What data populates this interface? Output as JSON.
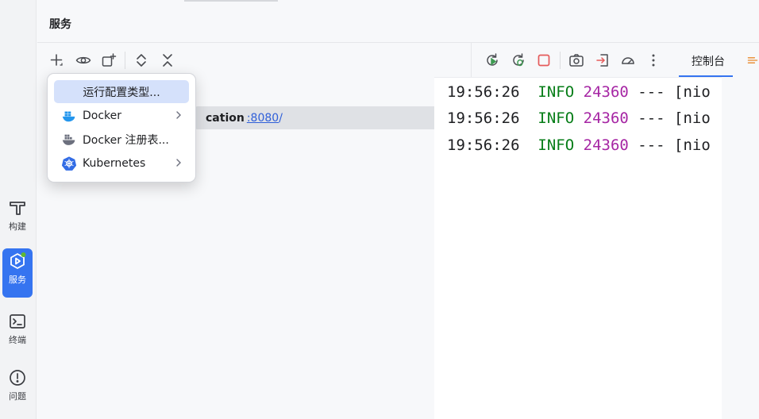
{
  "sidebar": {
    "tools": [
      {
        "label": "构建",
        "icon": "hammer-icon"
      },
      {
        "label": "服务",
        "icon": "services-icon",
        "active": true
      },
      {
        "label": "终端",
        "icon": "terminal-icon"
      },
      {
        "label": "问题",
        "icon": "problems-icon"
      }
    ]
  },
  "panel": {
    "title": "服务",
    "toolbar": {
      "left_icons": [
        "add-icon",
        "eye-icon",
        "new-group-icon",
        "expand-all-icon",
        "collapse-all-icon"
      ],
      "right_icons": [
        "rerun-icon",
        "restart-debug-icon",
        "stop-icon",
        "screenshot-icon",
        "login-icon",
        "profiler-icon",
        "more-icon"
      ]
    },
    "tree": {
      "selected_app": "cation",
      "port": ":8080",
      "port_suffix": "/"
    }
  },
  "console": {
    "tab_label": "控制台",
    "lines": [
      {
        "time": "19:56:26",
        "level": "INFO",
        "pid": "24360",
        "rest": "--- [nio"
      },
      {
        "time": "19:56:26",
        "level": "INFO",
        "pid": "24360",
        "rest": "--- [nio"
      },
      {
        "time": "19:56:26",
        "level": "INFO",
        "pid": "24360",
        "rest": "--- [nio"
      }
    ]
  },
  "popup_menu": {
    "items": [
      {
        "label": "运行配置类型...",
        "selected": true
      },
      {
        "label": "Docker",
        "icon": "docker-icon",
        "submenu": true
      },
      {
        "label": "Docker 注册表...",
        "icon": "docker-registry-icon"
      },
      {
        "label": "Kubernetes",
        "icon": "kubernetes-icon",
        "submenu": true
      }
    ]
  },
  "colors": {
    "accent": "#3574f0",
    "log_level": "#067d17",
    "log_pid": "#a626a4",
    "link": "#2f5fd9",
    "stop_red": "#e55b5b",
    "run_green": "#3f9b52"
  }
}
